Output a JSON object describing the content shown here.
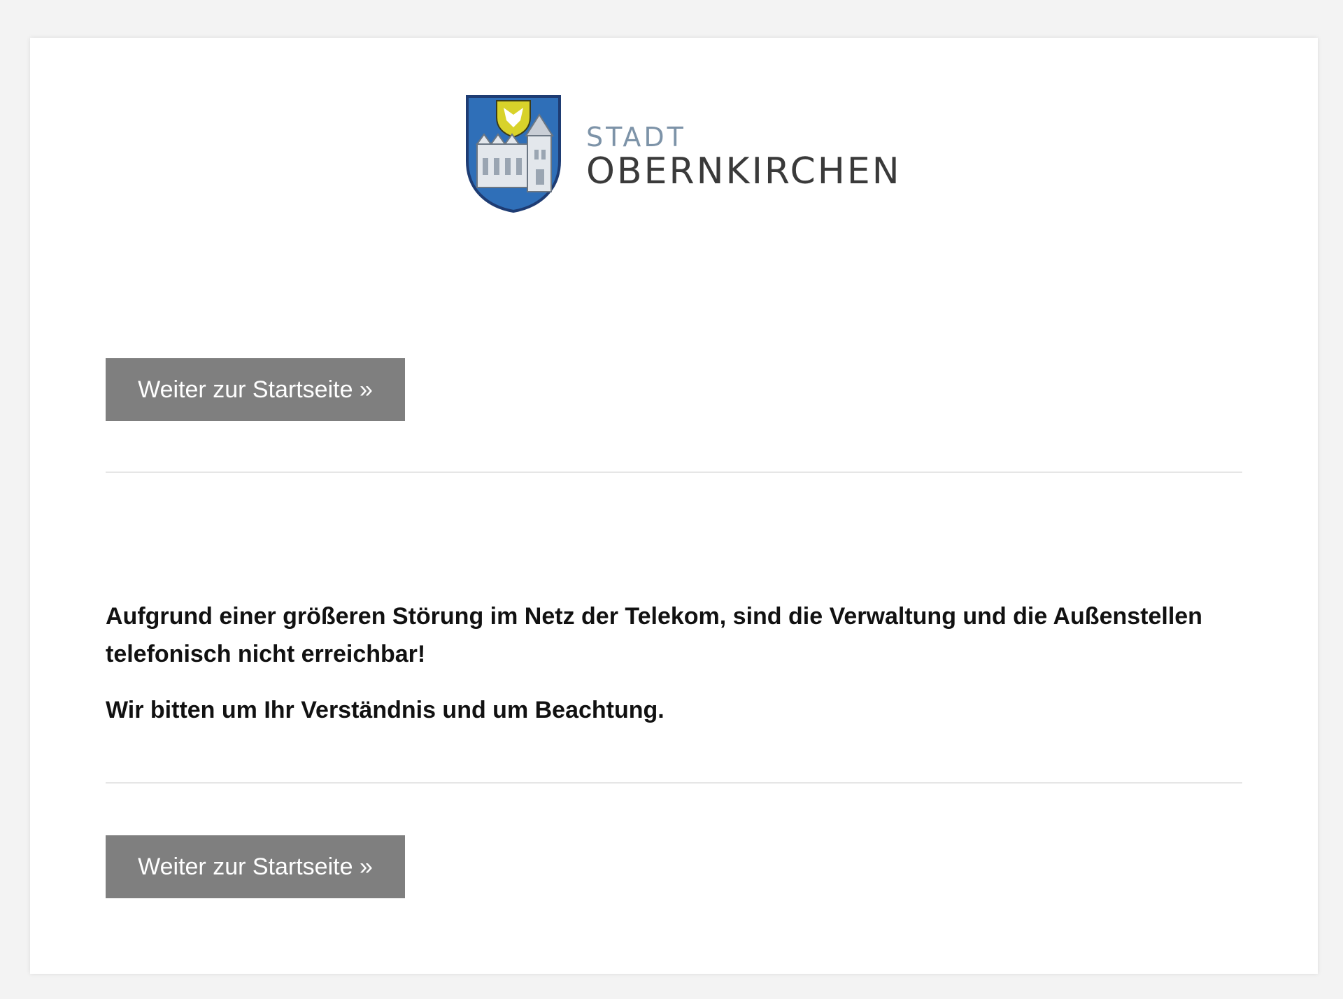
{
  "logo": {
    "line1": "STADT",
    "line2": "OBERNKIRCHEN",
    "crest_icon": "coat-of-arms-icon",
    "colors": {
      "shield_blue": "#2f6fb8",
      "shield_outline": "#1e3c73",
      "castle_grey": "#e3e7ec",
      "inner_shield_yellow": "#d8d22a"
    }
  },
  "buttons": {
    "top_label": "Weiter zur Startseite »",
    "bottom_label": "Weiter zur Startseite »",
    "color": "#7f7f7f"
  },
  "notice": {
    "paragraph1": "Aufgrund einer größeren Störung im Netz der Telekom, sind die Verwaltung und die Außenstellen telefonisch nicht erreichbar!",
    "paragraph2": "Wir bitten um Ihr Verständnis und um Beachtung."
  }
}
